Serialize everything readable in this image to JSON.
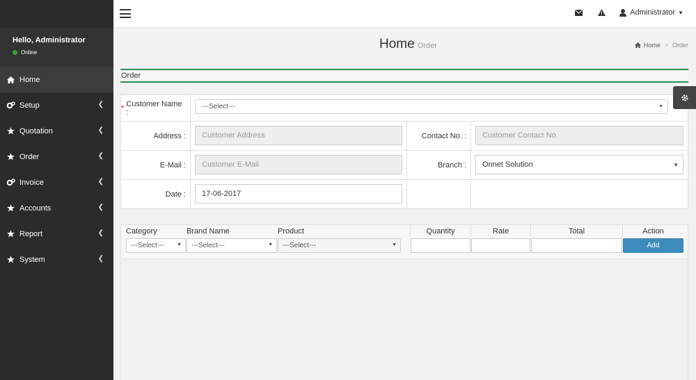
{
  "sidebar": {
    "greeting": "Hello, Administrator",
    "status": "Online",
    "items": [
      {
        "label": "Home",
        "icon": "home-icon",
        "has_children": false
      },
      {
        "label": "Setup",
        "icon": "cogs-icon",
        "has_children": true
      },
      {
        "label": "Quotation",
        "icon": "star-icon",
        "has_children": true
      },
      {
        "label": "Order",
        "icon": "star-icon",
        "has_children": true
      },
      {
        "label": "Invoice",
        "icon": "cogs-icon",
        "has_children": true
      },
      {
        "label": "Accounts",
        "icon": "star-icon",
        "has_children": true
      },
      {
        "label": "Report",
        "icon": "star-icon",
        "has_children": true
      },
      {
        "label": "System",
        "icon": "star-icon",
        "has_children": true
      }
    ]
  },
  "header": {
    "user_label": "Administrator",
    "icons": [
      "envelope-icon",
      "warning-icon",
      "user-icon"
    ]
  },
  "page": {
    "title": "Home",
    "subtitle": "Order",
    "breadcrumb": {
      "home": "Home",
      "current": "Order"
    },
    "box_title": "Order"
  },
  "form": {
    "customer_name_label": "Customer Name :",
    "customer_name_value": "---Select---",
    "address_label": "Address :",
    "address_placeholder": "Customer Address",
    "contact_label": "Contact No. :",
    "contact_placeholder": "Customer Contact No.",
    "email_label": "E-Mail :",
    "email_placeholder": "Customer E-Mail",
    "branch_label": "Branch :",
    "branch_value": "Onnet Solution",
    "date_label": "Date :",
    "date_value": "17-06-2017"
  },
  "items": {
    "headers": {
      "category": "Category",
      "brand": "Brand Name",
      "product": "Product",
      "quantity": "Quantity",
      "rate": "Rate",
      "total": "Total",
      "action": "Action"
    },
    "category_value": "---Select---",
    "brand_value": "---Select---",
    "product_value": "---Select---",
    "add_label": "Add"
  },
  "colors": {
    "sidebar_bg": "#2b2b2b",
    "accent_green": "#2e8b57",
    "button_blue": "#3c8dbc",
    "online_dot": "#3c9c3c"
  }
}
